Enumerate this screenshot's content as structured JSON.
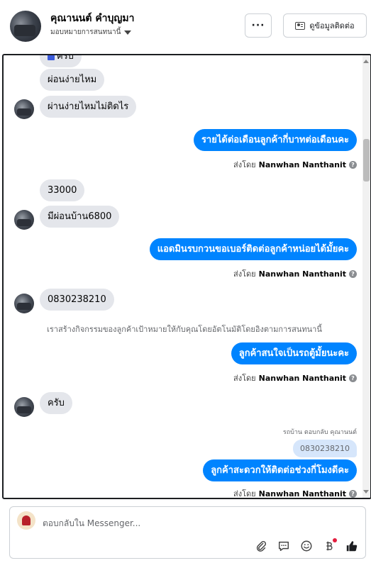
{
  "header": {
    "name": "คุณานนต์ คำบุญมา",
    "assignment": "มอบหมายการสนทนานี้",
    "more_label": "···",
    "contact_label": "ดูข้อมูลติดต่อ"
  },
  "messages": {
    "m0": "ครับ",
    "m1": "ผ่อนง่ายไหม",
    "m2": "ผ่านง่ายไหมไม่ติดไร",
    "m3": "รายได้ต่อเดือนลูกค้ากี่บาทต่อเดือนคะ",
    "m4": "33000",
    "m5": "มีผ่อนบ้าน6800",
    "m6": "แอดมินรบกวนขอเบอร์ติดต่อลูกค้าหน่อยได้มั้ยคะ",
    "m7": "0830238210",
    "m8": "ลูกค้าสนใจเป็นรถตู้มั้ยนะคะ",
    "m9": "ครับ",
    "m10": "ลูกค้าสะดวกให้ติดต่อช่วงกี่โมงดีคะ"
  },
  "sent_by": {
    "prefix": "ส่งโดย",
    "name": "Nanwhan Nanthanit"
  },
  "system_notice": "เราสร้างกิจกรรมของลูกค้าเป้าหมายให้กับคุณโดยอัตโนมัติโดยอิงตามการสนทนานี้",
  "reply": {
    "label": "รถบ้าน ตอบกลับ คุณานนต์",
    "quoted": "0830238210"
  },
  "composer": {
    "placeholder": "ตอบกลับใน Messenger..."
  },
  "icons": [
    "attach-icon",
    "comment-icon",
    "emoji-icon",
    "baht-icon",
    "thumbs-up-icon"
  ],
  "colors": {
    "outgoing": "#0084ff",
    "incoming": "#e4e6eb",
    "quoted": "#d6e6fb"
  }
}
